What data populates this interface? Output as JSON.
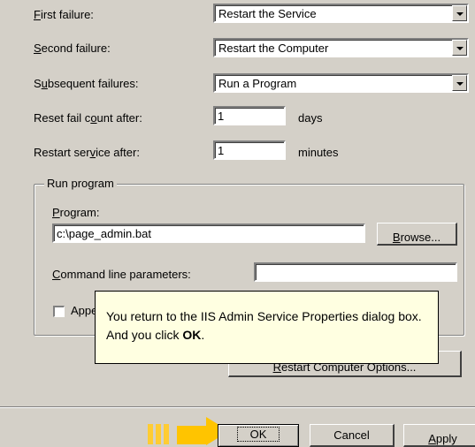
{
  "recovery": {
    "first_failure": {
      "label_pre": "",
      "label_u": "F",
      "label_post": "irst failure:",
      "value": "Restart the Service"
    },
    "second_failure": {
      "label_pre": "",
      "label_u": "S",
      "label_post": "econd failure:",
      "value": "Restart the Computer"
    },
    "subsequent_failures": {
      "label_pre": "S",
      "label_u": "u",
      "label_post": "bsequent failures:",
      "value": "Run a Program"
    },
    "reset_fail_count": {
      "label_pre": "Reset fail c",
      "label_u": "o",
      "label_post": "unt after:",
      "value": "1",
      "unit": "days"
    },
    "restart_service": {
      "label_pre": "Restart ser",
      "label_u": "v",
      "label_post": "ice after:",
      "value": "1",
      "unit": "minutes"
    }
  },
  "run_program": {
    "title": "Run program",
    "program_label_u": "P",
    "program_label_post": "rogram:",
    "program_value": "c:\\page_admin.bat",
    "browse_u": "B",
    "browse_post": "rowse...",
    "cmd_label_u": "C",
    "cmd_label_post": "ommand line parameters:",
    "cmd_value": "",
    "append_label": "Appe"
  },
  "restart_options_u": "R",
  "restart_options_post": "estart Computer Options...",
  "tooltip": {
    "text_pre": "You return to the IIS Admin Service Properties dialog box. And you click ",
    "text_bold": "OK",
    "text_post": "."
  },
  "footer": {
    "ok": "OK",
    "cancel": "Cancel",
    "apply_u": "A",
    "apply_post": "pply"
  },
  "colors": {
    "tooltip_bg": "#ffffe1",
    "pointer": "#ffc400",
    "dialog_bg": "#d4d0c8"
  }
}
